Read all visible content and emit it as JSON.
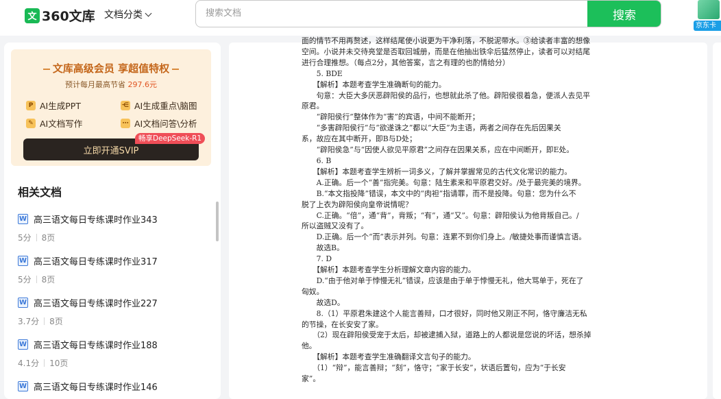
{
  "header": {
    "logo_badge": "文",
    "logo_text": "360文库",
    "doc_category_label": "文档分类",
    "search_placeholder": "搜索文档",
    "search_button": "搜索",
    "jd_label": "京东卡"
  },
  "vip": {
    "title": "文库高级会员 享超值特权",
    "save_prefix": "预计每月最高节省",
    "save_amount": "297.6元",
    "features": [
      {
        "icon": "P",
        "label": "AI生成PPT"
      },
      {
        "icon": "⋲",
        "label": "AI生成重点\\脑图"
      },
      {
        "icon": "✎",
        "label": "AI文档写作"
      },
      {
        "icon": "⋯",
        "label": "AI文档问答\\分析"
      }
    ],
    "deepseek_tag": "畅享DeepSeek-R1",
    "open_button": "立即开通SVIP"
  },
  "related": {
    "title": "相关文档",
    "items": [
      {
        "name": "高三语文每日专练课时作业343",
        "score": "5分",
        "pages": "8页"
      },
      {
        "name": "高三语文每日专练课时作业317",
        "score": "5分",
        "pages": "8页"
      },
      {
        "name": "高三语文每日专练课时作业227",
        "score": "3.7分",
        "pages": "8页"
      },
      {
        "name": "高三语文每日专练课时作业188",
        "score": "4.1分",
        "pages": "10页"
      },
      {
        "name": "高三语文每日专练课时作业146",
        "score": "",
        "pages": ""
      }
    ]
  },
  "document": {
    "lines": [
      "面的情节不用再赘述，这样结尾使小说更为干净利落，不脱泥带水。③给读者丰富的想像",
      "空间。小说并未交待亮堂是否取回城册，而是在他抽出铁伞后猛然停止，读者可以对结尾",
      "进行合理推想。（每点2分，其他答案，言之有理的也酌情给分）",
      "　　5. BDE",
      "　　【解析】本题考查学生准确断句的能力。",
      "　　句意：大臣大多厌恶辟阳侯的品行，也想就此杀了他。辟阳侯很着急，便派人去见平",
      "原君。",
      "　　“辟阳侯行”整体作为“害”的宾语，中间不能断开；",
      "　　“多害辟阳侯行”与“欲遂诛之”都以“大臣”为主语，两者之间存在先后因果关",
      "系，故应在其中断开，即B与D处；",
      "　　“辟阳侯急”与“因使人欲见平原君”之间存在因果关系，应在中间断开，即E处。",
      "　　6. B",
      "　　【解析】本题考查学生辨析一词多义，了解并掌握常见的古代文化常识的能力。",
      "　　A.正确。后一个“善”指完美。句意：陆生素来和平原君交好。/处于最完美的境界。",
      "　　B.“本文指投降”错误，本文中的“肉袒”指请罪，而不是投降。句意：您为什么不",
      "脱了上衣为辟阳侯向皇帝说情呢？",
      "　　C.正确。“倍”，通“背”，背叛；“有”，通“又”。句意：辟阳侯认为他背叛自己。/",
      "所以盗贼又没有了。",
      "　　D.正确。后一个“而”表示并列。句意：连累不到你们身上。/敏捷处事而谨慎言语。",
      "　　故选B。",
      "　　7. D",
      "　　【解析】本题考查学生分析理解文章内容的能力。",
      "　　D.“由于他对单于悖慢无礼”错误，应该是由于单于悖慢无礼，他大骂单于，死在了",
      "匈奴。",
      "　　故选D。",
      "　　8.（1）平原君朱建这个人能言善辩，口才很好，同时他又刚正不阿，恪守廉洁无私",
      "的节操，在长安安了家。",
      "　　（2）现在辟阳侯受宠于太后，却被逮捕入狱，道路上的人都说是您说的坏话，想杀掉",
      "他。",
      "　　【解析】本题考查学生准确翻译文言句子的能力。",
      "　　（1）“辩”，能言善辩；“刻”，恪守；“家于长安”，状语后置句，应为“于长安",
      "家”。"
    ]
  }
}
